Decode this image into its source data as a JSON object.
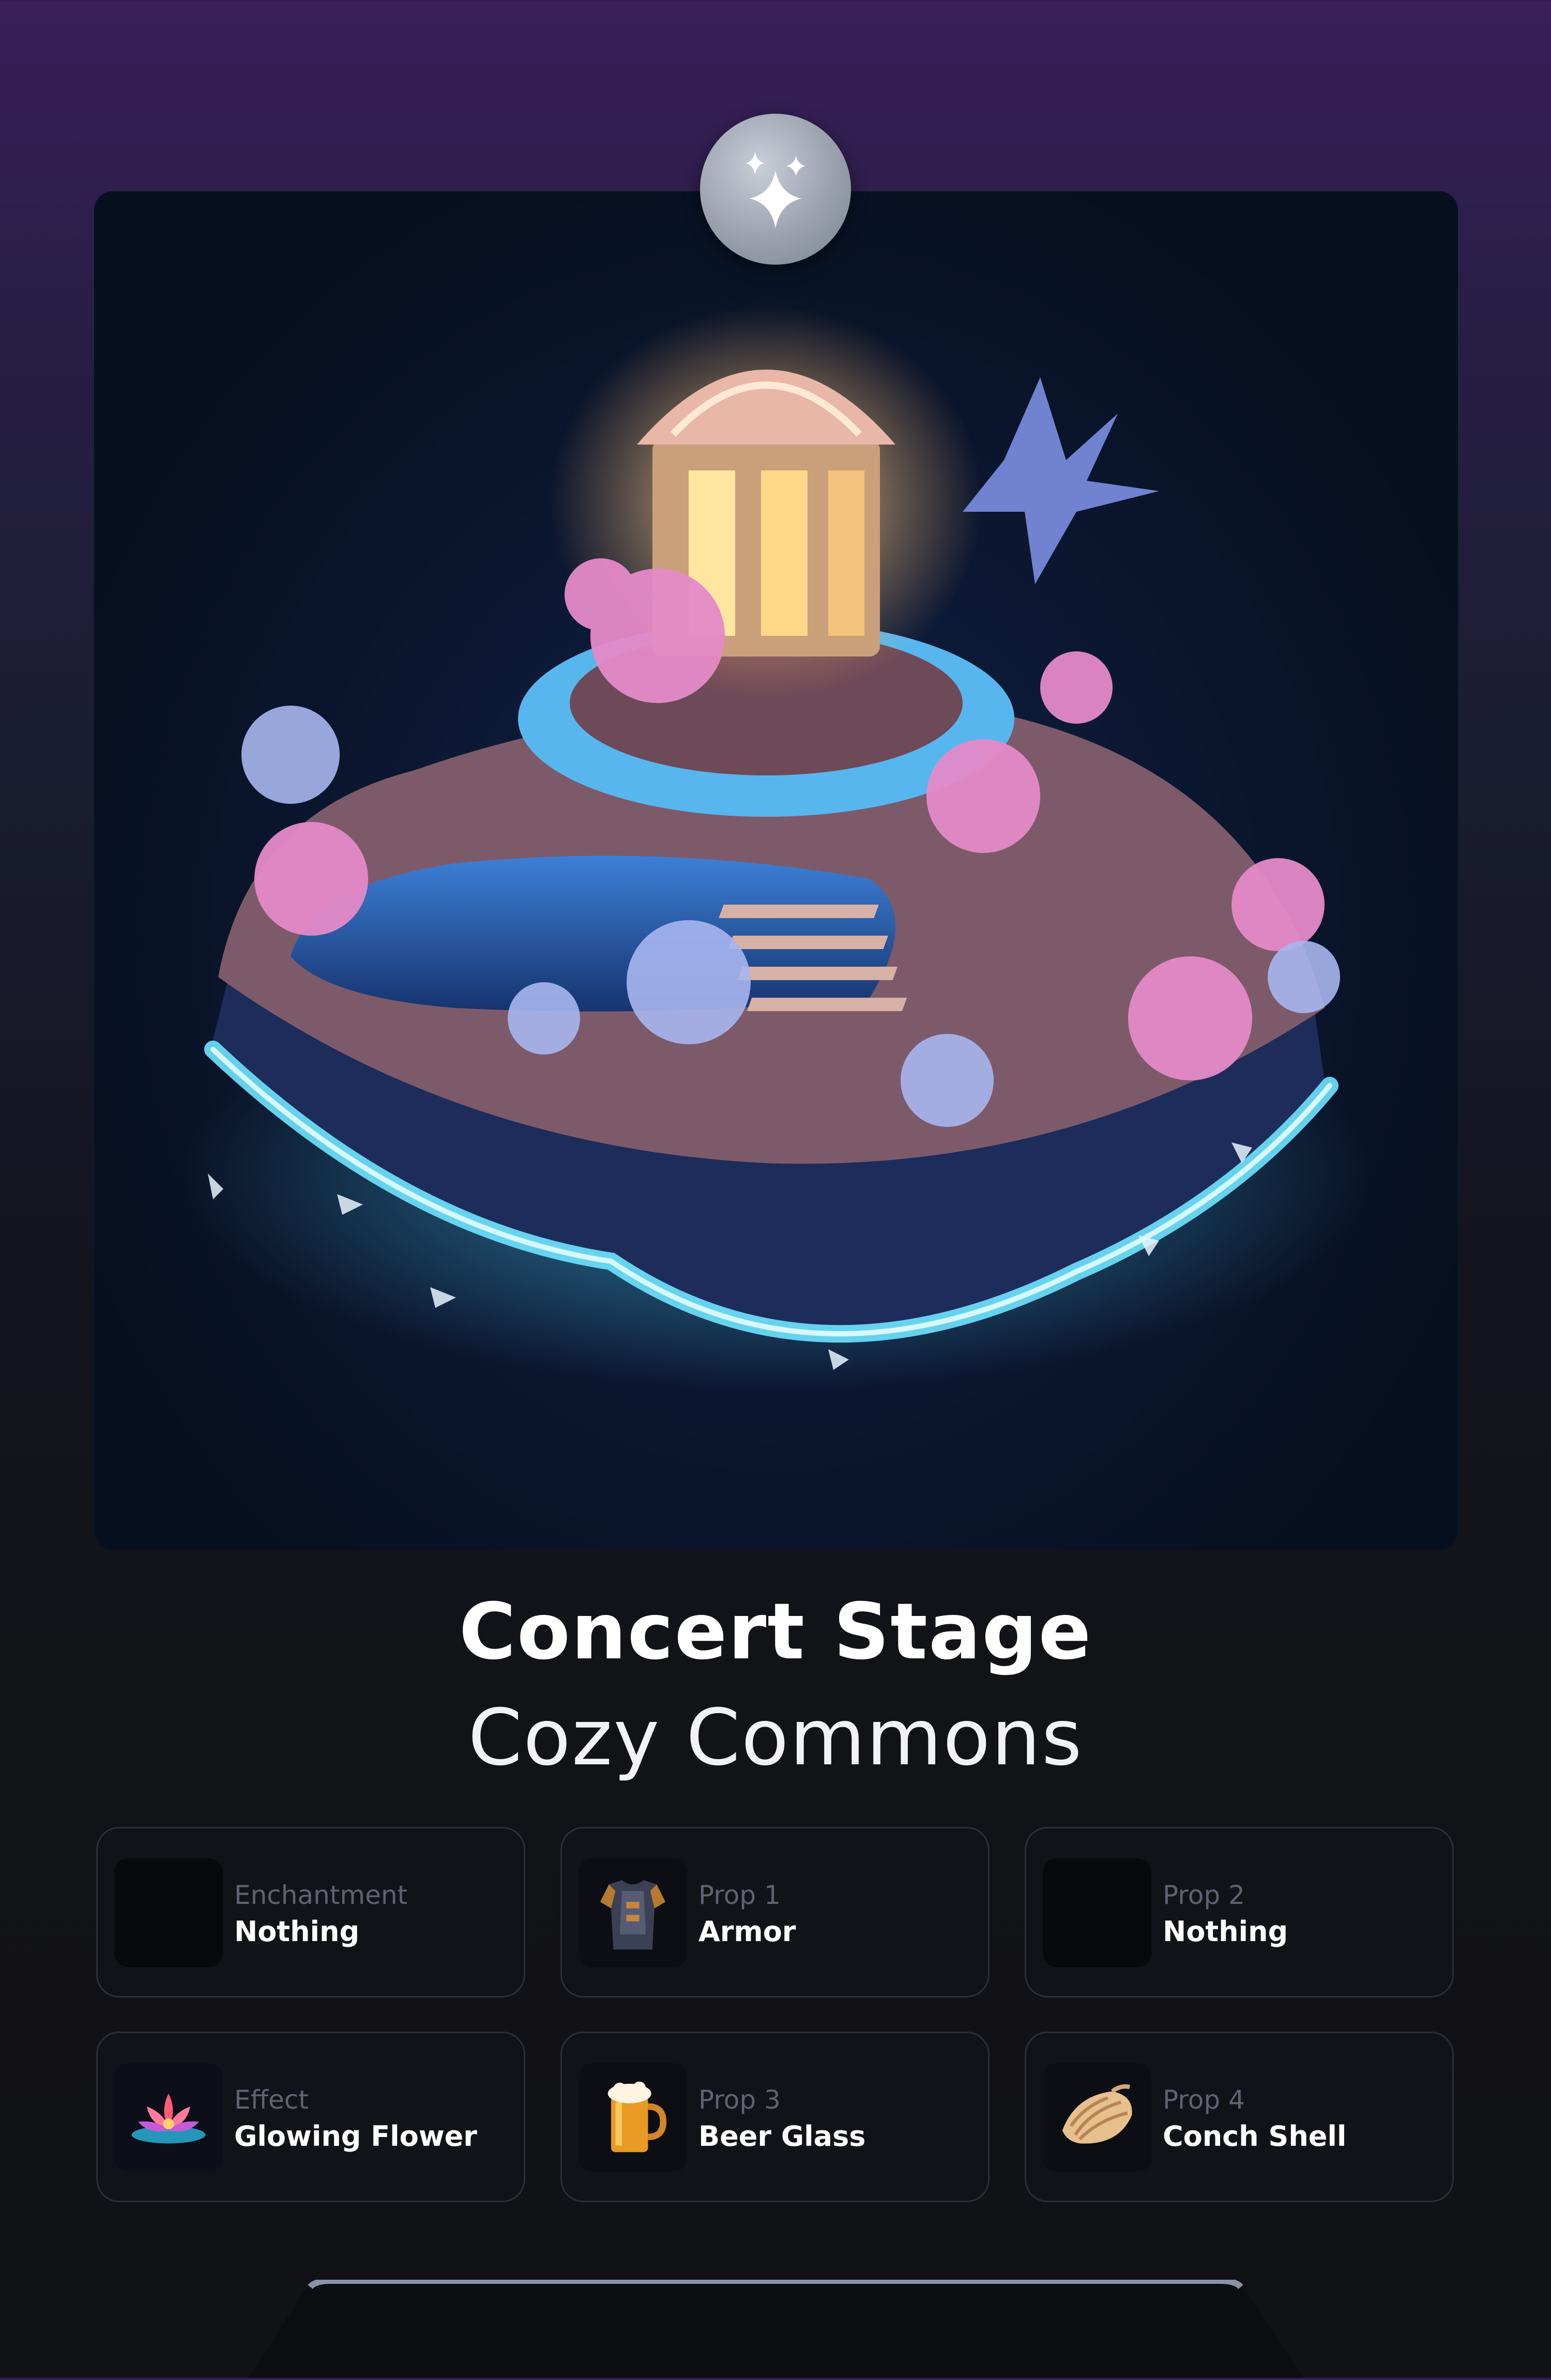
{
  "badge": {
    "icon": "sparkles-icon"
  },
  "item": {
    "name": "Concert Stage",
    "collection": "Cozy Commons"
  },
  "slots": [
    {
      "label": "Enchantment",
      "value": "Nothing",
      "icon": "empty-slot"
    },
    {
      "label": "Prop 1",
      "value": "Armor",
      "icon": "armor-icon"
    },
    {
      "label": "Prop 2",
      "value": "Nothing",
      "icon": "empty-slot"
    },
    {
      "label": "Effect",
      "value": "Glowing Flower",
      "icon": "glowing-flower-icon"
    },
    {
      "label": "Prop 3",
      "value": "Beer Glass",
      "icon": "beer-glass-icon"
    },
    {
      "label": "Prop 4",
      "value": "Conch Shell",
      "icon": "conch-shell-icon"
    }
  ],
  "colors": {
    "glow": "#4fd6ff",
    "blossom": "#e58ac8",
    "panel": "#121319"
  }
}
